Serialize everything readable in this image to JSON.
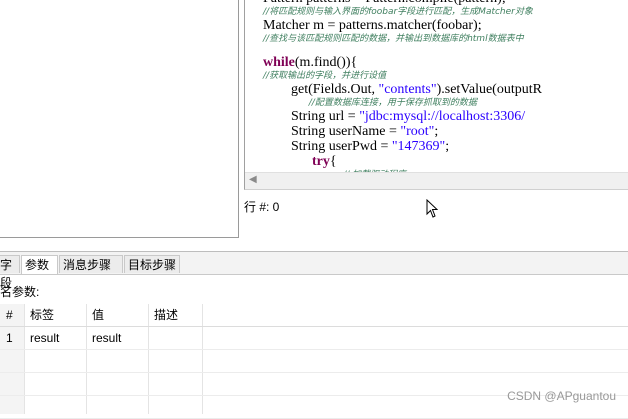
{
  "editor": {
    "lines": [
      {
        "type": "code",
        "parts": [
          {
            "t": "Pattern patterns = Pattern.compile(pattern);",
            "c": ""
          }
        ]
      },
      {
        "type": "comment",
        "text": "//将匹配规则与输入界面的foobar字段进行匹配，生成Matcher对象"
      },
      {
        "type": "code",
        "parts": [
          {
            "t": "Matcher m = patterns.matcher(foobar);",
            "c": ""
          }
        ]
      },
      {
        "type": "comment",
        "text": "//查找与该匹配规则匹配的数据，并输出到数据库的html数据表中"
      },
      {
        "type": "blank"
      },
      {
        "type": "code",
        "parts": [
          {
            "t": "while",
            "c": "kw"
          },
          {
            "t": "(m.find()){",
            "c": ""
          }
        ]
      },
      {
        "type": "comment",
        "text": "//获取输出的字段，并进行设值"
      },
      {
        "type": "code",
        "parts": [
          {
            "t": "        get(Fields.Out, ",
            "c": ""
          },
          {
            "t": "\"contents\"",
            "c": "str"
          },
          {
            "t": ").setValue(outputR",
            "c": ""
          }
        ]
      },
      {
        "type": "comment",
        "text": "                //配置数据库连接，用于保存抓取到的数据"
      },
      {
        "type": "code",
        "parts": [
          {
            "t": "        String url = ",
            "c": ""
          },
          {
            "t": "\"jdbc:mysql://localhost:3306/",
            "c": "str"
          }
        ]
      },
      {
        "type": "code",
        "parts": [
          {
            "t": "        String userName = ",
            "c": ""
          },
          {
            "t": "\"root\"",
            "c": "str"
          },
          {
            "t": ";",
            "c": ""
          }
        ]
      },
      {
        "type": "code",
        "parts": [
          {
            "t": "        String userPwd = ",
            "c": ""
          },
          {
            "t": "\"147369\"",
            "c": "str"
          },
          {
            "t": ";",
            "c": ""
          }
        ]
      },
      {
        "type": "code",
        "parts": [
          {
            "t": "              ",
            "c": ""
          },
          {
            "t": "try",
            "c": "kw"
          },
          {
            "t": "{",
            "c": ""
          }
        ]
      },
      {
        "type": "comment",
        "text": "                            // 加载驱动程序"
      }
    ]
  },
  "status": {
    "row_label": "行 #: 0"
  },
  "tabs": [
    "字段",
    "参数",
    "消息步骤",
    "目标步骤"
  ],
  "active_tab": "参数",
  "params": {
    "label": "命名参数:",
    "columns": [
      "#",
      "标签",
      "值",
      "描述"
    ],
    "rows": [
      {
        "num": "1",
        "label": "result",
        "value": "result",
        "desc": ""
      }
    ]
  },
  "watermark": "CSDN @APguantou"
}
